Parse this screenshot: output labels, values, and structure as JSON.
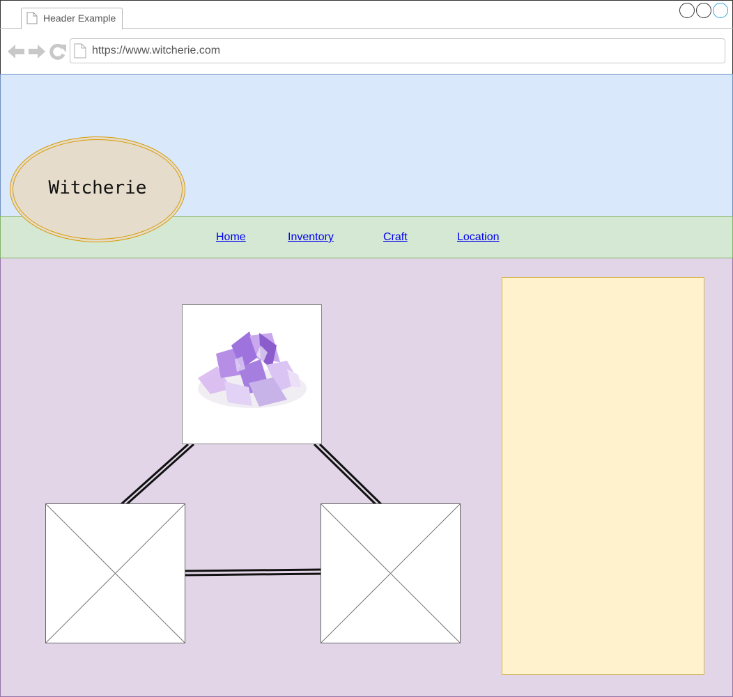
{
  "browser": {
    "tab_title": "Header Example",
    "url": "https://www.witcherie.com",
    "icons": [
      "document-icon",
      "back-arrow-icon",
      "forward-arrow-icon",
      "reload-icon",
      "window-control-icon"
    ]
  },
  "logo": {
    "text": "Witcherie"
  },
  "nav": {
    "items": [
      {
        "label": "Home"
      },
      {
        "label": "Inventory"
      },
      {
        "label": "Craft"
      },
      {
        "label": "Location"
      }
    ]
  },
  "colors": {
    "header_band": "#dae8fc",
    "nav_band": "#d5e8d4",
    "content_band": "#e1d5e7",
    "sidebar": "#fff2cc",
    "logo_fill": "#e6dccb",
    "link": "#0000ee"
  }
}
